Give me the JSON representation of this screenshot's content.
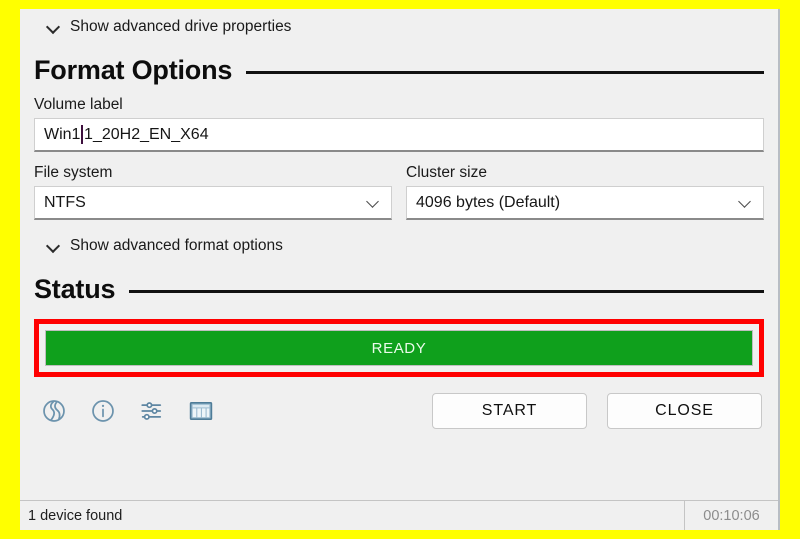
{
  "window": {
    "annotation_color": "#FFFF00",
    "highlight_color": "#FF0000"
  },
  "drive_properties": {
    "toggle_label": "Show advanced drive properties",
    "icon": "chevron-down-icon"
  },
  "format_options": {
    "heading": "Format Options",
    "volume_label": {
      "label": "Volume label",
      "value_before_caret": "Win1",
      "value_after_caret": "1_20H2_EN_X64",
      "full_value": "Win11_20H2_EN_X64"
    },
    "file_system": {
      "label": "File system",
      "value": "NTFS",
      "icon": "chevron-down-icon"
    },
    "cluster_size": {
      "label": "Cluster size",
      "value": "4096 bytes (Default)",
      "icon": "chevron-down-icon"
    },
    "advanced_toggle_label": "Show advanced format options"
  },
  "status_section": {
    "heading": "Status",
    "progress_text": "READY",
    "progress_color": "#0FA01C"
  },
  "toolbar_icons": [
    {
      "name": "globe-icon",
      "title": "globe"
    },
    {
      "name": "info-icon",
      "title": "info"
    },
    {
      "name": "settings-sliders-icon",
      "title": "settings"
    },
    {
      "name": "log-grid-icon",
      "title": "log"
    }
  ],
  "actions": {
    "start_label": "START",
    "close_label": "CLOSE"
  },
  "status_bar": {
    "message": "1 device found",
    "timer": "00:10:06"
  }
}
